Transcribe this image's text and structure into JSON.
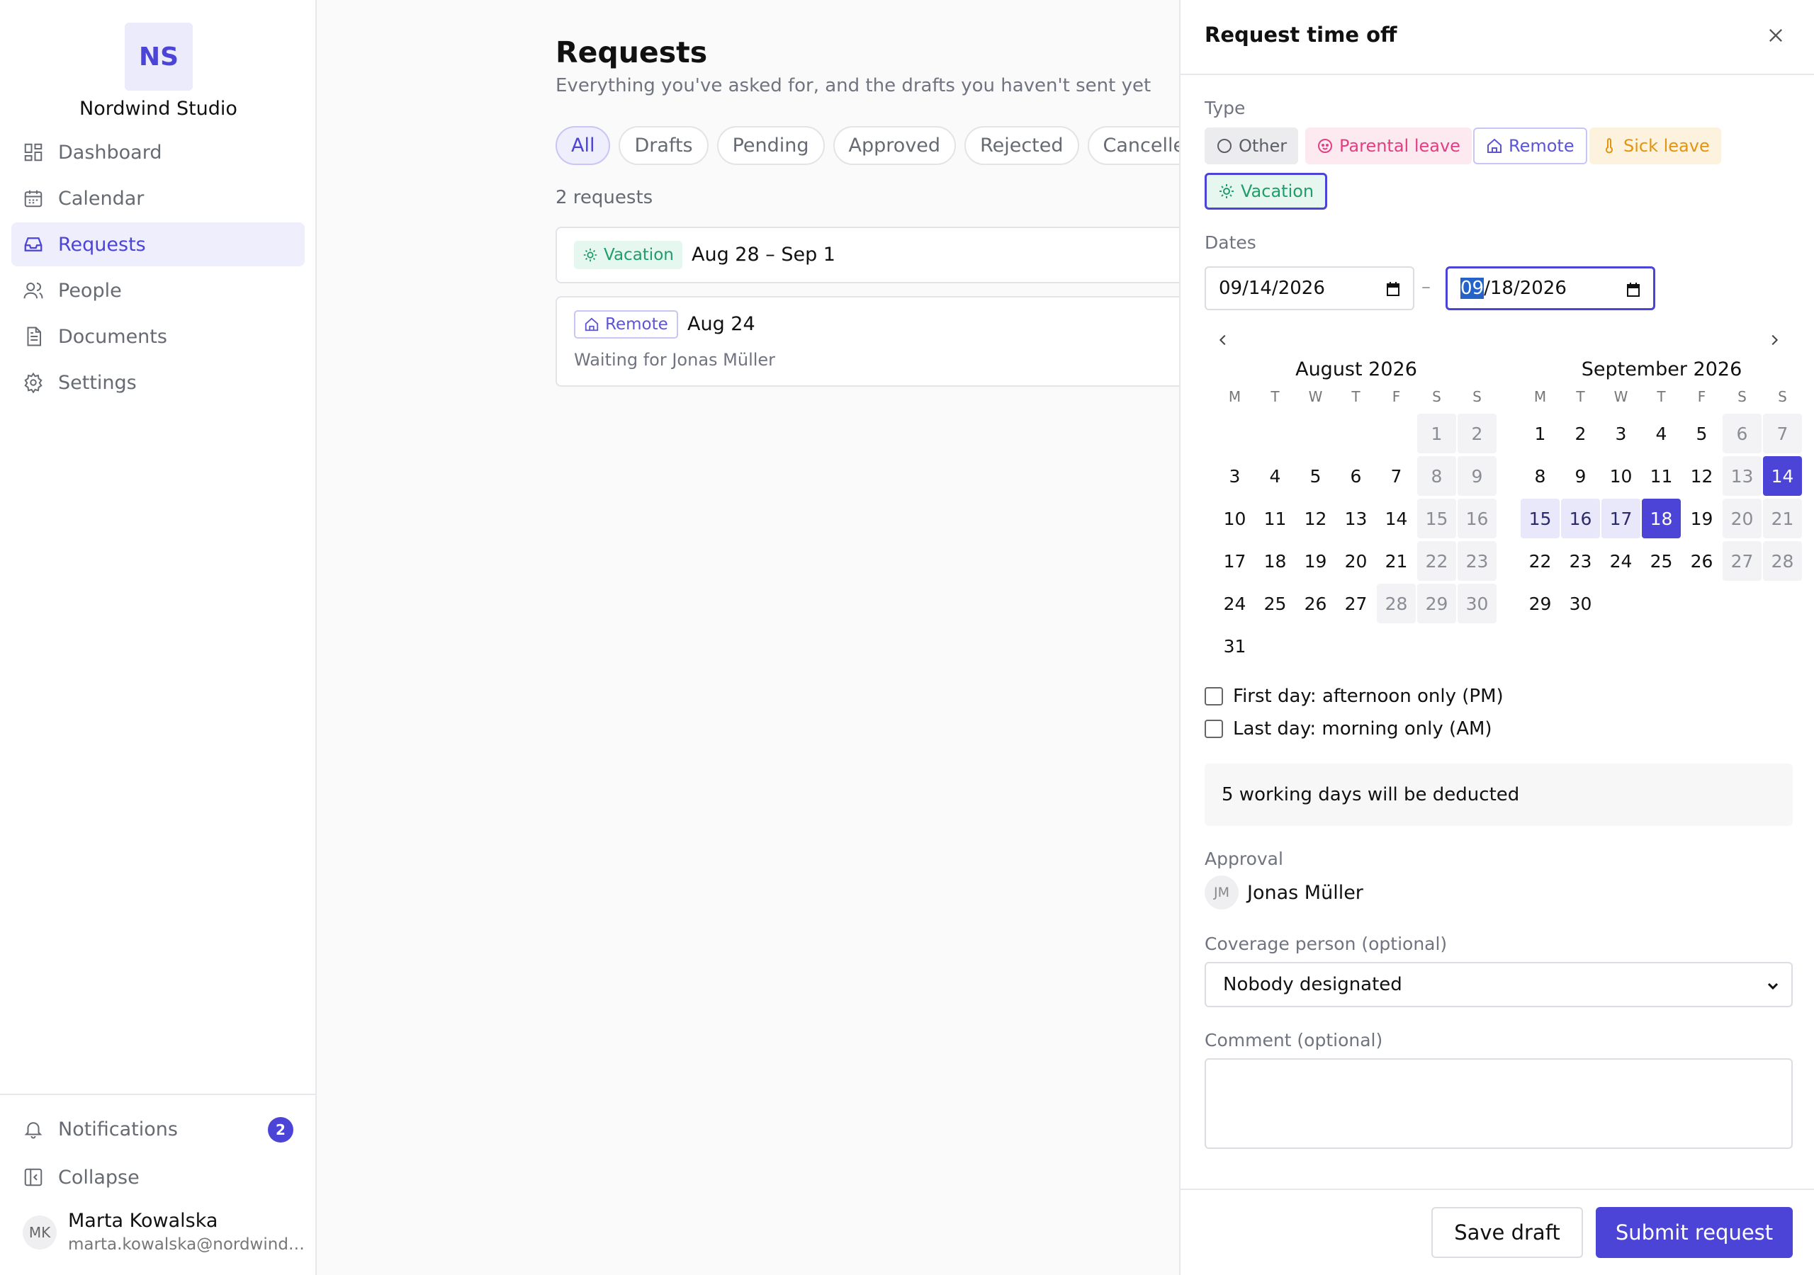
{
  "sidebar": {
    "logo": "NS",
    "org_name": "Nordwind Studio",
    "items": [
      {
        "label": "Dashboard",
        "icon": "dashboard-icon"
      },
      {
        "label": "Calendar",
        "icon": "calendar-icon"
      },
      {
        "label": "Requests",
        "icon": "inbox-icon",
        "active": true
      },
      {
        "label": "People",
        "icon": "people-icon"
      },
      {
        "label": "Documents",
        "icon": "document-icon"
      },
      {
        "label": "Settings",
        "icon": "gear-icon"
      }
    ],
    "notifications": {
      "label": "Notifications",
      "count": "2"
    },
    "collapse_label": "Collapse",
    "user": {
      "initials": "MK",
      "name": "Marta Kowalska",
      "email": "marta.kowalska@nordwindstudio.com"
    }
  },
  "main": {
    "title": "Requests",
    "subtitle": "Everything you've asked for, and the drafts you haven't sent yet",
    "filters": [
      "All",
      "Drafts",
      "Pending",
      "Approved",
      "Rejected",
      "Cancelled"
    ],
    "active_filter": "All",
    "count_text": "2 requests",
    "requests": [
      {
        "type": "Vacation",
        "dates": "Aug 28 – Sep 1",
        "status": ""
      },
      {
        "type": "Remote",
        "dates": "Aug 24",
        "status": "Waiting for Jonas Müller"
      }
    ]
  },
  "drawer": {
    "title": "Request time off",
    "type_label": "Type",
    "types": [
      {
        "label": "Other",
        "icon": "circle-icon"
      },
      {
        "label": "Parental leave",
        "icon": "baby-icon"
      },
      {
        "label": "Remote",
        "icon": "home-icon"
      },
      {
        "label": "Sick leave",
        "icon": "thermometer-icon"
      },
      {
        "label": "Vacation",
        "icon": "sun-icon",
        "selected": true
      }
    ],
    "dates_label": "Dates",
    "start_date": "09/14/2026",
    "end_date_month": "09",
    "end_date_rest": "/18/2026",
    "date_separator": "–",
    "calendars": [
      {
        "title": "August 2026",
        "first_weekday": 6,
        "days": 31,
        "holidays": [
          28
        ]
      },
      {
        "title": "September 2026",
        "first_weekday": 1,
        "days": 30,
        "holidays": []
      }
    ],
    "weekdays": [
      "M",
      "T",
      "W",
      "T",
      "F",
      "S",
      "S"
    ],
    "range": {
      "month": 1,
      "start": 14,
      "end": 18
    },
    "first_day_pm_label": "First day: afternoon only (PM)",
    "last_day_am_label": "Last day: morning only (AM)",
    "deduction_text": "5 working days will be deducted",
    "approval_label": "Approval",
    "approver": {
      "initials": "JM",
      "name": "Jonas Müller"
    },
    "coverage_label": "Coverage person (optional)",
    "coverage_value": "Nobody designated",
    "comment_label": "Comment (optional)",
    "comment_value": "",
    "save_draft_label": "Save draft",
    "submit_label": "Submit request"
  },
  "colors": {
    "accent": "#4b44d6",
    "vacation": "#1f9d6a",
    "parental": "#e23f82",
    "sick": "#e3940f"
  }
}
